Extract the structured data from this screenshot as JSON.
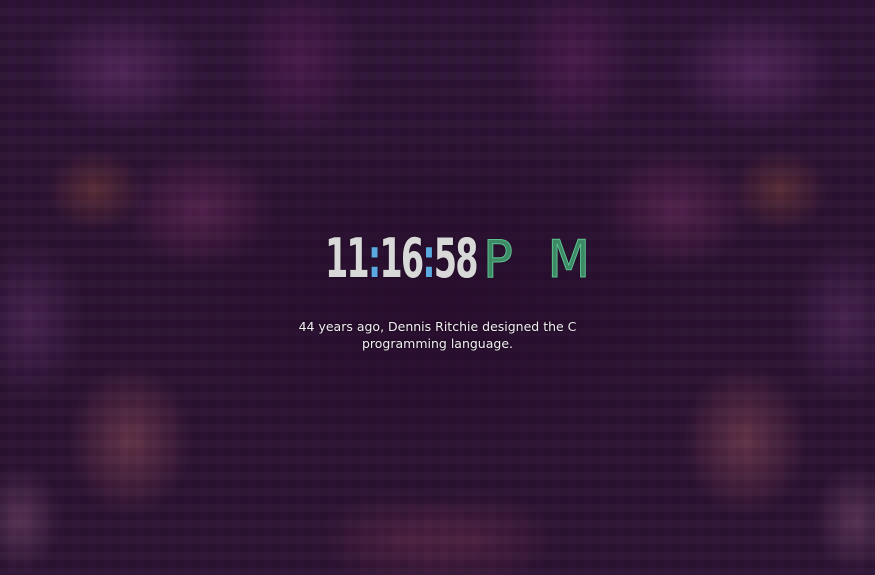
{
  "clock": {
    "hours": "11",
    "separator1": ":",
    "minutes": "16",
    "separator2": ":",
    "seconds": "58",
    "meridiem": "P M"
  },
  "fact": {
    "text": "44 years ago, Dennis Ritchie designed the C programming language."
  },
  "colors": {
    "background": "#2b1233",
    "clock_digits": "#d8d8d8",
    "clock_separator": "#5aa9e0",
    "meridiem": "#5fc290",
    "fact_text": "#f1eef2"
  }
}
